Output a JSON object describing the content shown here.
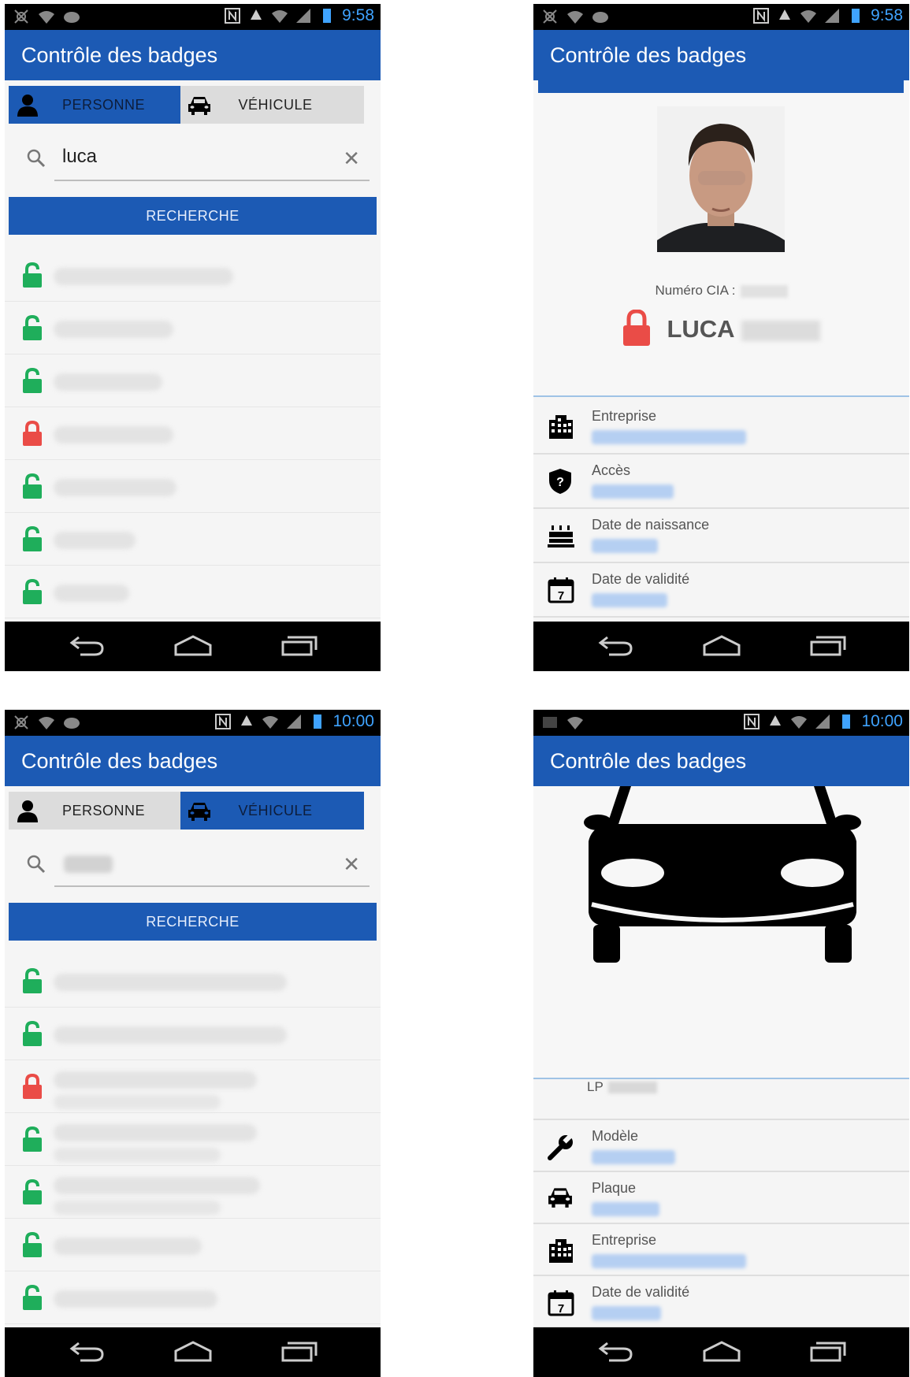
{
  "app": {
    "title": "Contrôle des badges",
    "accent": "#1c5ab4",
    "lock_open_color": "#1fae5b",
    "lock_closed_color": "#ea4c47"
  },
  "screens": [
    {
      "time": "9:58",
      "tabs": [
        {
          "label": "PERSONNE",
          "icon": "person-icon",
          "active": true
        },
        {
          "label": "VÉHICULE",
          "icon": "car-icon",
          "active": false
        }
      ],
      "search": {
        "value": "luca"
      },
      "button": "RECHERCHE",
      "results": [
        {
          "status": "open"
        },
        {
          "status": "open"
        },
        {
          "status": "open"
        },
        {
          "status": "closed"
        },
        {
          "status": "open"
        },
        {
          "status": "open"
        },
        {
          "status": "open"
        }
      ]
    },
    {
      "time": "9:58",
      "cia_label": "Numéro CIA :",
      "first_name": "LUCA",
      "status": "closed",
      "fields": [
        {
          "label": "Entreprise",
          "icon": "building-icon"
        },
        {
          "label": "Accès",
          "icon": "shield-question-icon"
        },
        {
          "label": "Date de naissance",
          "icon": "birthday-cake-icon"
        },
        {
          "label": "Date de validité",
          "icon": "calendar-icon"
        }
      ]
    },
    {
      "time": "10:00",
      "tabs": [
        {
          "label": "PERSONNE",
          "icon": "person-icon",
          "active": false
        },
        {
          "label": "VÉHICULE",
          "icon": "car-icon",
          "active": true
        }
      ],
      "button": "RECHERCHE",
      "results": [
        {
          "status": "open"
        },
        {
          "status": "open"
        },
        {
          "status": "closed"
        },
        {
          "status": "open"
        },
        {
          "status": "open"
        },
        {
          "status": "open"
        },
        {
          "status": "open"
        }
      ]
    },
    {
      "time": "10:00",
      "lp_label": "LP",
      "fields": [
        {
          "label": "Modèle",
          "icon": "wrench-icon"
        },
        {
          "label": "Plaque",
          "icon": "car-icon"
        },
        {
          "label": "Entreprise",
          "icon": "building-icon"
        },
        {
          "label": "Date de validité",
          "icon": "calendar-icon"
        }
      ]
    }
  ]
}
